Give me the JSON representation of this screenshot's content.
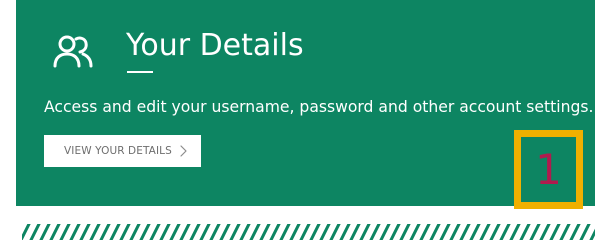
{
  "panel": {
    "title": "Your Details",
    "description": "Access and edit your username, password and other account settings.",
    "button_label": "VIEW YOUR DETAILS",
    "icon": "users-icon",
    "button_icon": "chevron-right-icon"
  },
  "annotation": {
    "number": "1"
  },
  "colors": {
    "panel_background": "#0d8562",
    "text": "#ffffff",
    "button_background": "#ffffff",
    "button_text": "#6e6e6e",
    "callout_border": "#f0b000",
    "callout_number": "#b01b4e",
    "hatch": "#0d8562"
  }
}
